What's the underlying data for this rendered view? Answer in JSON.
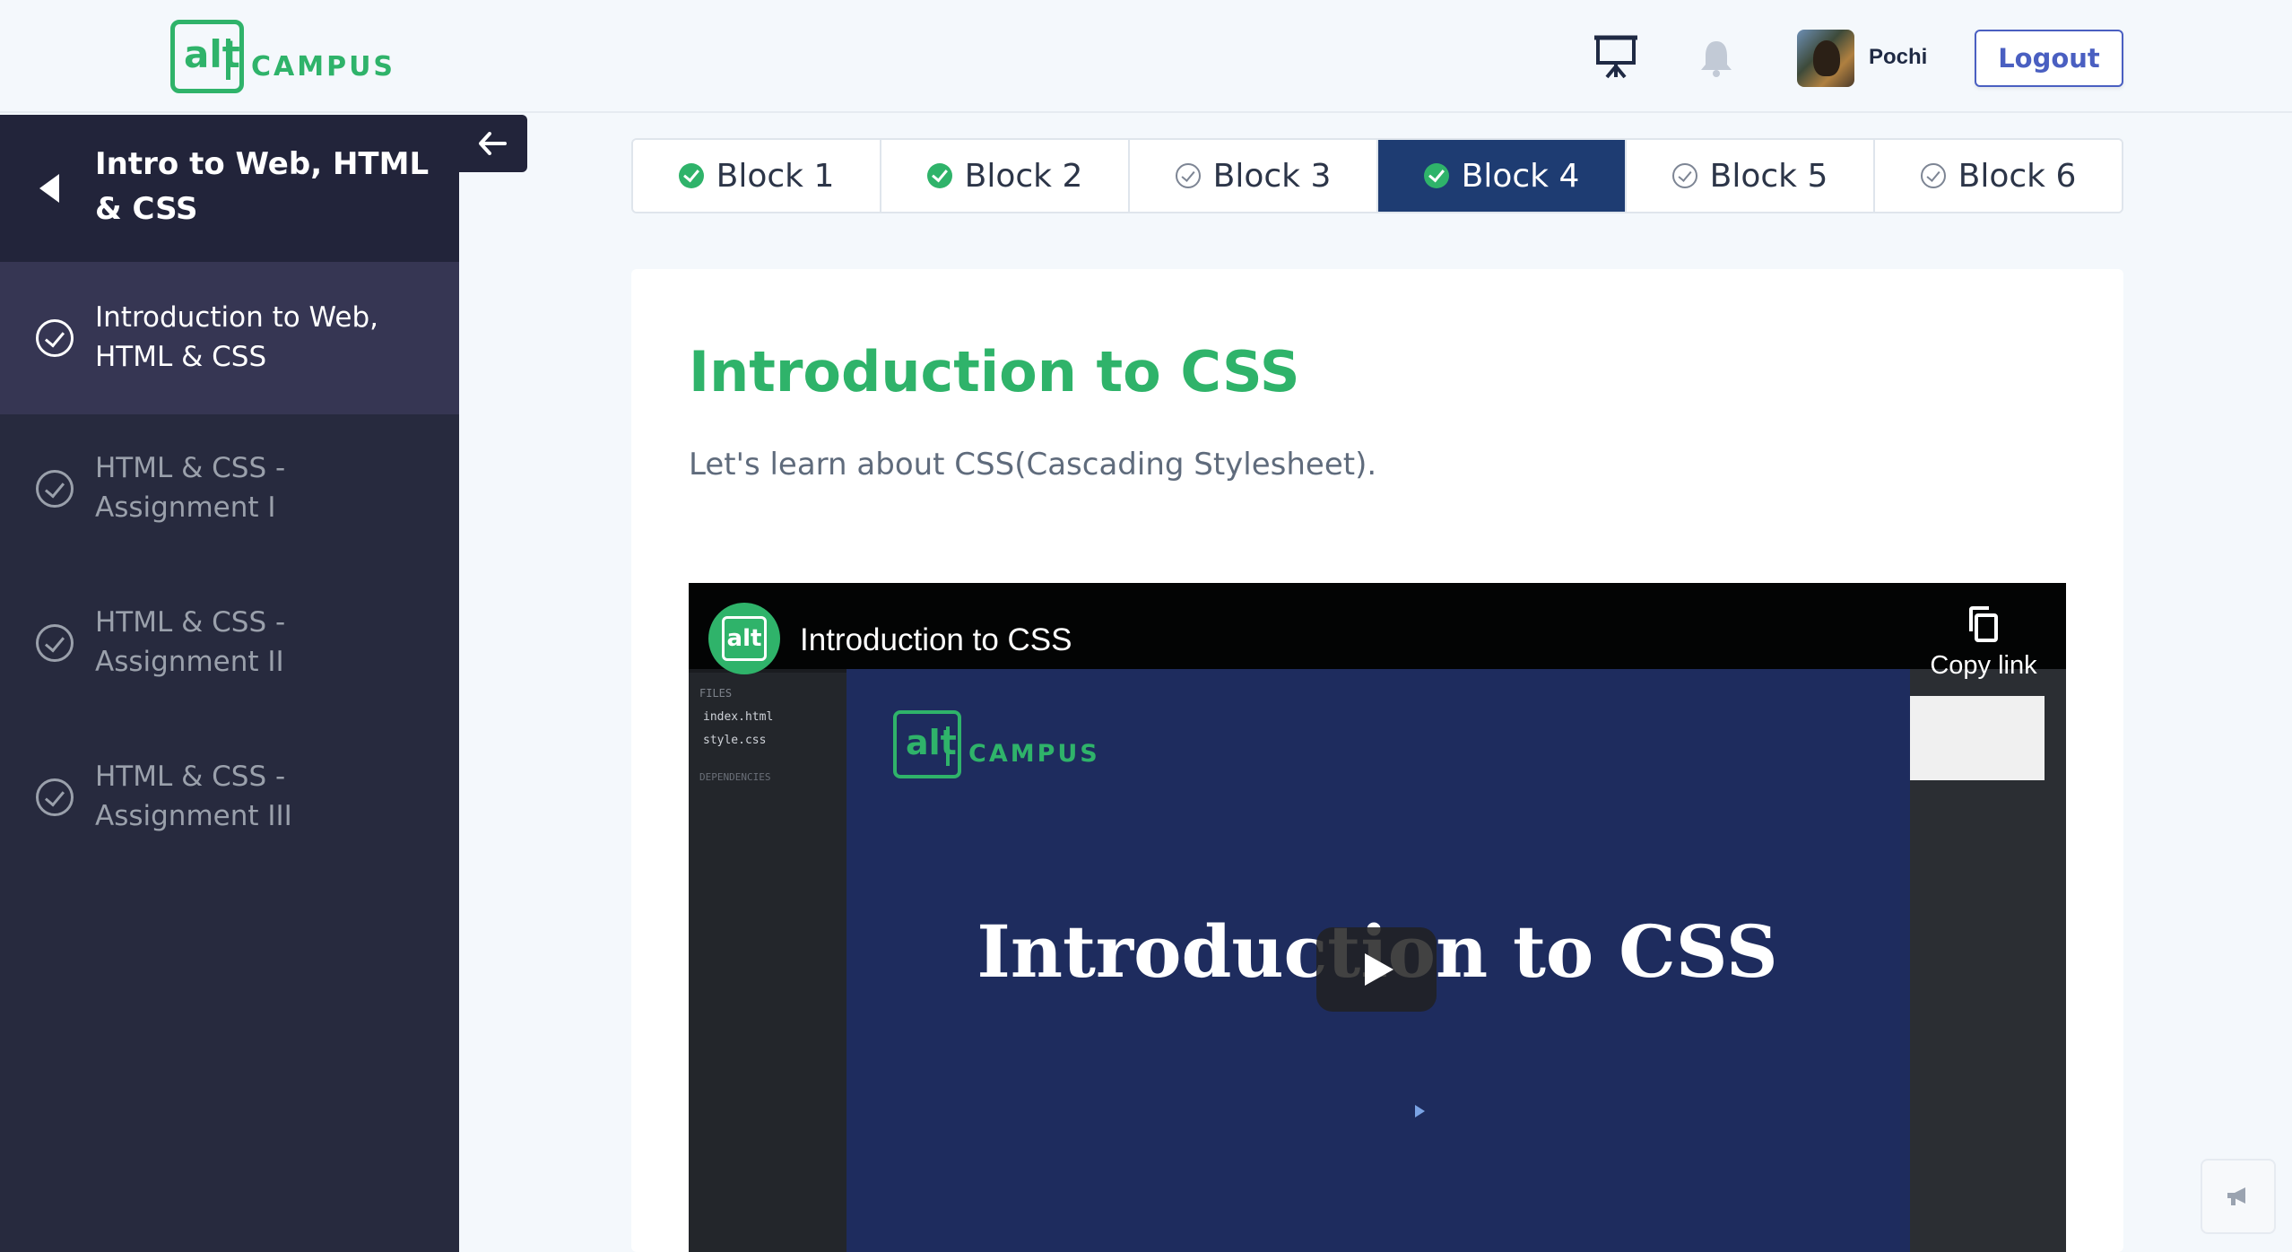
{
  "header": {
    "logo_alt": "alt",
    "logo_text": "CAMPUS",
    "username": "Pochi",
    "logout_label": "Logout"
  },
  "sidebar": {
    "title": "Intro to Web, HTML & CSS",
    "items": [
      {
        "label": "Introduction to Web, HTML & CSS",
        "active": true
      },
      {
        "label": "HTML & CSS - Assignment I",
        "active": false
      },
      {
        "label": "HTML & CSS - Assignment II",
        "active": false
      },
      {
        "label": "HTML & CSS - Assignment III",
        "active": false
      }
    ]
  },
  "tabs": [
    {
      "label": "Block 1",
      "status": "done"
    },
    {
      "label": "Block 2",
      "status": "done"
    },
    {
      "label": "Block 3",
      "status": "todo"
    },
    {
      "label": "Block 4",
      "status": "done",
      "active": true
    },
    {
      "label": "Block 5",
      "status": "todo"
    },
    {
      "label": "Block 6",
      "status": "todo"
    }
  ],
  "content": {
    "title": "Introduction to CSS",
    "description": "Let's learn about CSS(Cascading Stylesheet)."
  },
  "video": {
    "channel_avatar": "alt",
    "title": "Introduction to CSS",
    "copy_link_label": "Copy link",
    "slide_logo_alt": "alt",
    "slide_logo_text": "CAMPUS",
    "slide_heading": "Introduction to CSS",
    "files_label": "FILES",
    "file_1": "index.html",
    "file_2": "style.css",
    "deps_label": "DEPENDENCIES"
  },
  "colors": {
    "brand_green": "#2fb36a",
    "sidebar_bg": "#272a3e",
    "active_tab": "#1e3c72",
    "logout_accent": "#4a5fc1"
  }
}
